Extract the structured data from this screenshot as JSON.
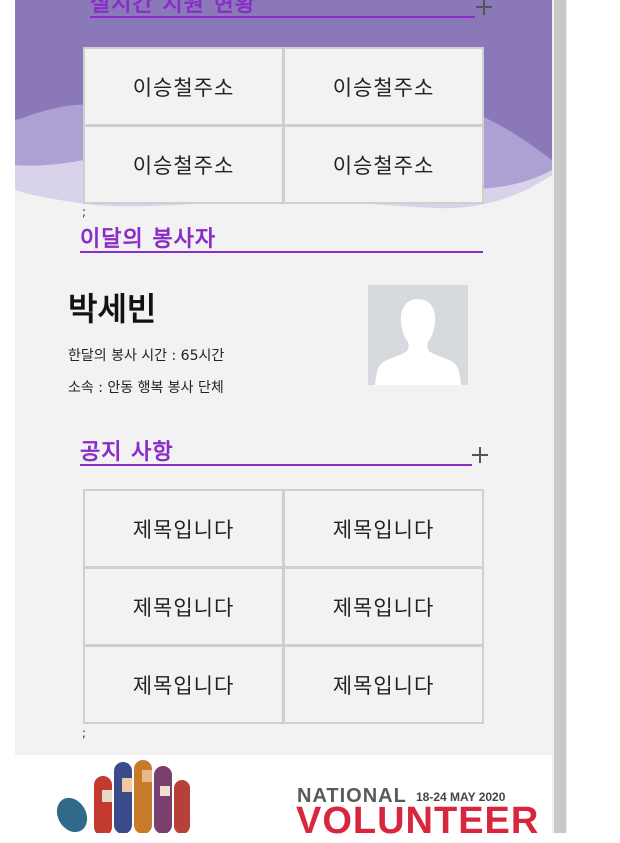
{
  "realtime_section": {
    "title": "실시간 지원 현황",
    "items": [
      "이승철주소",
      "이승철주소",
      "이승철주소",
      "이승철주소"
    ],
    "trailing_text": ";"
  },
  "monthly_volunteer": {
    "title": "이달의 봉사자",
    "name": "박세빈",
    "hours_text": "한달의 봉사 시간 : 65시간",
    "org_text": "소속 : 안동 행복 봉사 단체",
    "avatar_icon": "person-silhouette-icon"
  },
  "notice_section": {
    "title": "공지 사항",
    "items": [
      "제목입니다",
      "제목입니다",
      "제목입니다",
      "제목입니다",
      "제목입니다",
      "제목입니다"
    ],
    "trailing_text": ";"
  },
  "banner": {
    "national": "NATIONAL",
    "dates": "18-24 MAY 2020",
    "volunteer": "VOLUNTEER"
  },
  "colors": {
    "accent_purple": "#8a2cc7",
    "hero_purple": "#8a78b9",
    "banner_red": "#d7263d"
  }
}
